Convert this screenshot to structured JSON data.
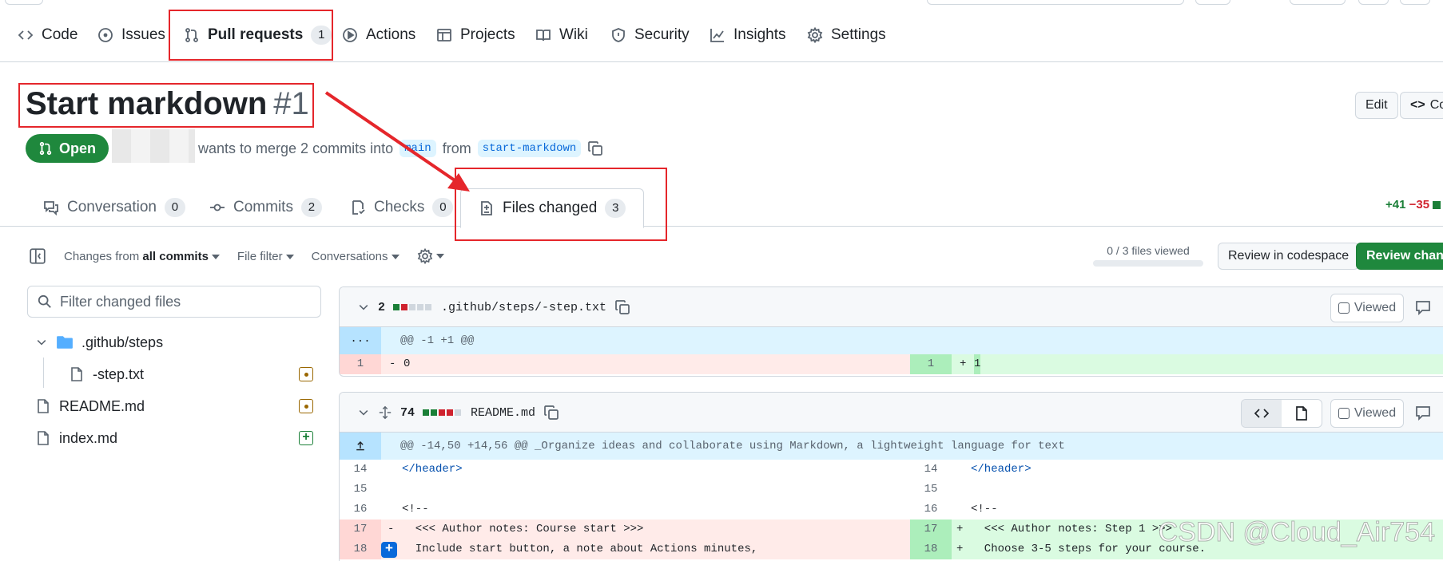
{
  "nav": {
    "items": [
      {
        "label": "Code",
        "icon": "code-icon"
      },
      {
        "label": "Issues",
        "icon": "issue-icon"
      },
      {
        "label": "Pull requests",
        "icon": "pull-request-icon",
        "count": "1",
        "selected": true
      },
      {
        "label": "Actions",
        "icon": "play-icon"
      },
      {
        "label": "Projects",
        "icon": "table-icon"
      },
      {
        "label": "Wiki",
        "icon": "book-icon"
      },
      {
        "label": "Security",
        "icon": "shield-icon"
      },
      {
        "label": "Insights",
        "icon": "graph-icon"
      },
      {
        "label": "Settings",
        "icon": "gear-icon"
      }
    ]
  },
  "pr": {
    "title": "Start markdown",
    "number": "#1",
    "state": "Open",
    "merge_text": "wants to merge 2 commits into",
    "base_branch": "main",
    "from_text": "from",
    "head_branch": "start-markdown",
    "edit_label": "Edit",
    "code_label": "Co"
  },
  "tabs": [
    {
      "label": "Conversation",
      "count": "0",
      "icon": "comment-discussion-icon"
    },
    {
      "label": "Commits",
      "count": "2",
      "icon": "commit-icon"
    },
    {
      "label": "Checks",
      "count": "0",
      "icon": "checklist-icon"
    },
    {
      "label": "Files changed",
      "count": "3",
      "icon": "file-diff-icon",
      "active": true
    }
  ],
  "diffstat": {
    "additions": "+41",
    "deletions": "−35"
  },
  "toolbar": {
    "changes_from_prefix": "Changes from",
    "changes_from_value": "all commits",
    "file_filter": "File filter",
    "conversations": "Conversations",
    "files_viewed": "0 / 3 files viewed",
    "files_viewed_fraction": 0,
    "review_codespace": "Review in codespace",
    "review_changes": "Review change"
  },
  "file_tree": {
    "filter_placeholder": "Filter changed files",
    "folder": ".github/steps",
    "files": [
      {
        "name": "-step.txt",
        "status": "modified"
      },
      {
        "name": "README.md",
        "status": "modified"
      },
      {
        "name": "index.md",
        "status": "added"
      }
    ]
  },
  "diff_files": [
    {
      "changes": "2",
      "path": ".github/steps/-step.txt",
      "viewed_label": "Viewed",
      "hunk_gutter": "...",
      "hunk": "@@ -1 +1 @@",
      "lines": [
        {
          "old_no": "1",
          "old_sign": "-",
          "old_text": "0",
          "new_no": "1",
          "new_sign": "+",
          "new_text": "1"
        }
      ]
    },
    {
      "changes": "74",
      "path": "README.md",
      "viewed_label": "Viewed",
      "hunk": "@@ -14,50 +14,56 @@ _Organize ideas and collaborate using Markdown, a lightweight language for text",
      "lines": [
        {
          "old_no": "14",
          "old_text": "</header>",
          "new_no": "14",
          "new_text": "</header>"
        },
        {
          "old_no": "15",
          "old_text": "",
          "new_no": "15",
          "new_text": ""
        },
        {
          "old_no": "16",
          "old_text": "<!--",
          "new_no": "16",
          "new_text": "<!--"
        },
        {
          "old_no": "17",
          "old_sign": "-",
          "old_text": "  <<< Author notes: Course start >>>",
          "new_no": "17",
          "new_sign": "+",
          "new_text": "  <<< Author notes: Step 1 >>>"
        },
        {
          "old_no": "18",
          "old_sign": "+",
          "old_text": "  Include start button, a note about Actions minutes,",
          "new_no": "18",
          "new_sign": "+",
          "new_text": "  Choose 3-5 steps for your course."
        }
      ]
    }
  ],
  "watermark": "CSDN @Cloud_Air754",
  "colors": {
    "accent_green": "#1f883d",
    "annotation_red": "#e5262b",
    "link_blue": "#0969da"
  }
}
